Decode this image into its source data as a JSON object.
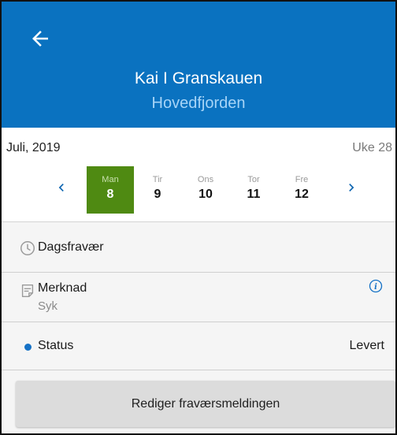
{
  "header": {
    "title": "Kai I Granskauen",
    "subtitle": "Hovedfjorden",
    "back_icon": "arrow-left-icon",
    "background": "#0a72c0"
  },
  "calendar": {
    "month": "Juli, 2019",
    "week": "Uke 28",
    "selected_color": "#4f8a12",
    "days": [
      {
        "name": "Man",
        "date": "8",
        "selected": true
      },
      {
        "name": "Tir",
        "date": "9"
      },
      {
        "name": "Ons",
        "date": "10"
      },
      {
        "name": "Tor",
        "date": "11"
      },
      {
        "name": "Fre",
        "date": "12"
      }
    ]
  },
  "details": {
    "absence_type": "Dagsfravær",
    "note_label": "Merknad",
    "note_value": "Syk",
    "status_label": "Status",
    "status_value": "Levert",
    "status_dot_color": "#1672c6"
  },
  "actions": {
    "edit_label": "Rediger fraværsmeldingen"
  }
}
